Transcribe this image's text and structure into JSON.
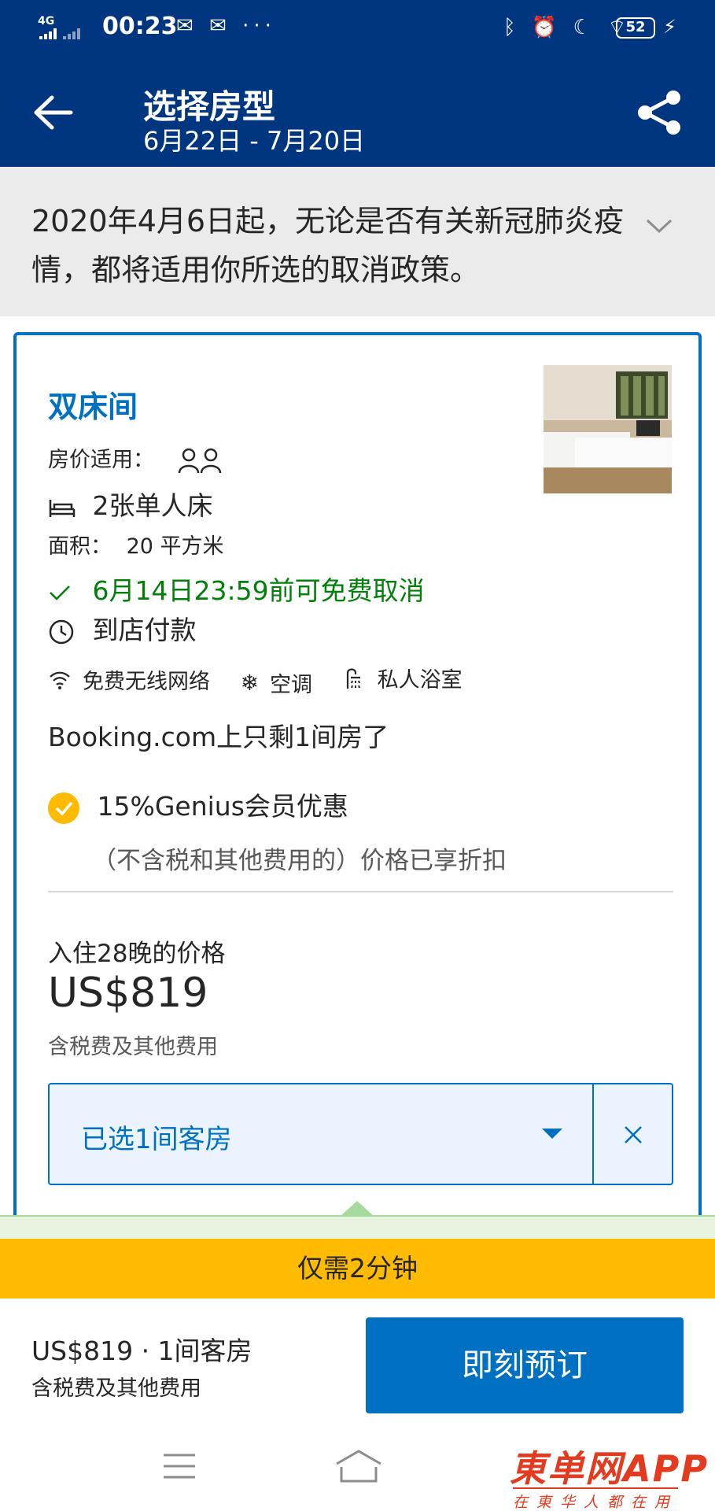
{
  "status_bar": {
    "network": "4G",
    "time": "00:23",
    "battery": "52",
    "left_icons": [
      "wechat-icon",
      "mail-icon",
      "more-icon"
    ],
    "right_icons": [
      "bluetooth-icon",
      "alarm-icon",
      "moon-icon",
      "wifi-icon",
      "battery-icon",
      "charging-icon"
    ]
  },
  "header": {
    "title": "选择房型",
    "dates": "6月22日 - 7月20日"
  },
  "notice": {
    "text": "2020年4月6日起，无论是否有关新冠肺炎疫情，都将适用你所选的取消政策。"
  },
  "room": {
    "name": "双床间",
    "price_applies_label": "房价适用：",
    "occupancy_guests": 2,
    "beds": "2张单人床",
    "area_label": "面积：",
    "area_value": "20 平方米",
    "free_cancel": "6月14日23:59前可免费取消",
    "payment": "到店付款",
    "amenities": [
      "免费无线网络",
      "空调",
      "私人浴室"
    ],
    "scarcity": "Booking.com上只剩1间房了",
    "genius": "15%Genius会员优惠",
    "discount_note": "（不含税和其他费用的）价格已享折扣",
    "price_label": "入住28晚的价格",
    "price": "US$819",
    "price_note": "含税费及其他费用",
    "selected": "已选1间客房"
  },
  "tooltip": {
    "text": "仅需2分钟"
  },
  "bottom_bar": {
    "summary": "US$819 · 1间客房",
    "note": "含税费及其他费用",
    "book_label": "即刻预订"
  },
  "watermark": {
    "main": "東单网APP",
    "sub": "在東华人都在用"
  },
  "colors": {
    "brand_blue": "#003580",
    "action_blue": "#0071c2",
    "genius_yellow": "#febb02",
    "success_green": "#008009"
  }
}
